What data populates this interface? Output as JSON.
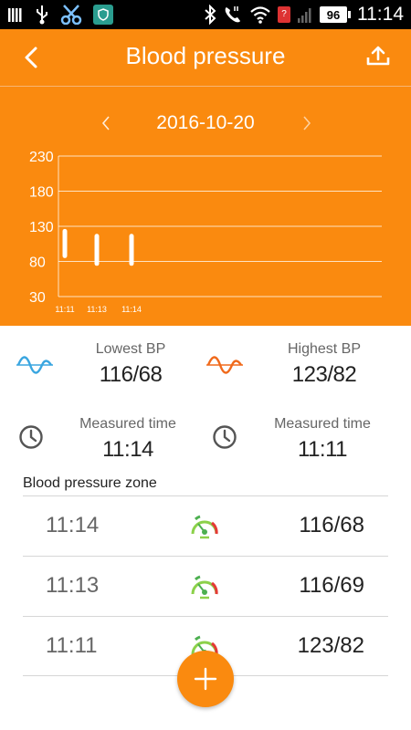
{
  "status_bar": {
    "time": "11:14",
    "battery": "96",
    "icons": [
      "signal-bars-icon",
      "usb-icon",
      "scissors-icon",
      "shield-icon",
      "bluetooth-icon",
      "phone-icon",
      "wifi-icon",
      "alert-icon",
      "cellular-icon",
      "battery-icon"
    ]
  },
  "header": {
    "title": "Blood pressure",
    "back_icon": "back-arrow-icon",
    "share_icon": "upload-icon"
  },
  "date_nav": {
    "date": "2016-10-20",
    "prev_icon": "chevron-left-icon",
    "next_icon": "chevron-right-icon"
  },
  "chart_data": {
    "type": "range-bar",
    "y_ticks": [
      "230",
      "180",
      "130",
      "80",
      "30"
    ],
    "y_tick_values": [
      230,
      180,
      130,
      80,
      30
    ],
    "ylim": [
      30,
      230
    ],
    "grid": true,
    "categories": [
      "11:11",
      "11:13",
      "11:14"
    ],
    "ranges": [
      {
        "time": "11:11",
        "low": 88,
        "high": 123
      },
      {
        "time": "11:13",
        "low": 77,
        "high": 116
      },
      {
        "time": "11:14",
        "low": 77,
        "high": 116
      }
    ],
    "colors": {
      "background": "#fa8a0f",
      "bar": "#ffffff",
      "grid": "#ffffff"
    }
  },
  "summary": {
    "lowest": {
      "label": "Lowest BP",
      "value": "116/68",
      "icon": "sine-wave-icon",
      "color": "#3aa6e0"
    },
    "highest": {
      "label": "Highest BP",
      "value": "123/82",
      "icon": "sine-wave-icon",
      "color": "#f06a1c"
    },
    "measured_left": {
      "label": "Measured time",
      "value": "11:14",
      "icon": "clock-icon"
    },
    "measured_right": {
      "label": "Measured time",
      "value": "11:11",
      "icon": "clock-icon"
    }
  },
  "zone": {
    "title": "Blood pressure zone",
    "items": [
      {
        "time": "11:14",
        "value": "116/68"
      },
      {
        "time": "11:13",
        "value": "116/69"
      },
      {
        "time": "11:11",
        "value": "123/82"
      }
    ],
    "gauge_icon": "gauge-icon"
  },
  "fab": {
    "icon": "plus-icon"
  },
  "colors": {
    "accent": "#fa8a0f"
  }
}
